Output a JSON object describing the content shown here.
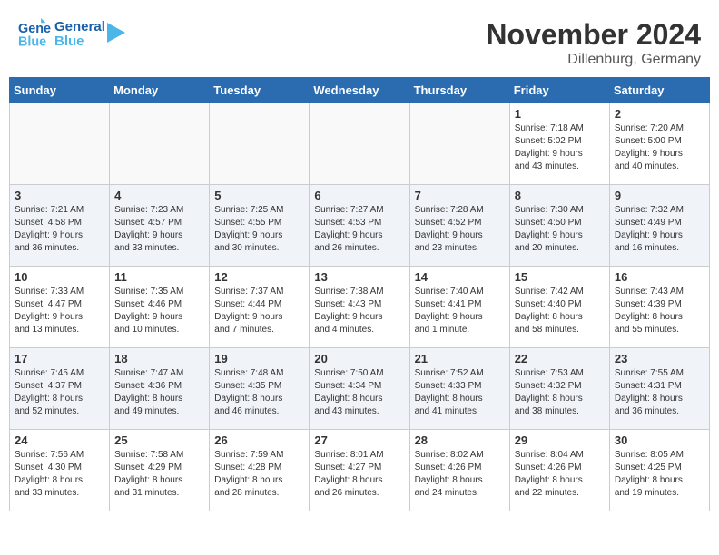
{
  "logo": {
    "line1": "General",
    "line2": "Blue"
  },
  "title": "November 2024",
  "location": "Dillenburg, Germany",
  "days_of_week": [
    "Sunday",
    "Monday",
    "Tuesday",
    "Wednesday",
    "Thursday",
    "Friday",
    "Saturday"
  ],
  "weeks": [
    [
      {
        "day": "",
        "info": ""
      },
      {
        "day": "",
        "info": ""
      },
      {
        "day": "",
        "info": ""
      },
      {
        "day": "",
        "info": ""
      },
      {
        "day": "",
        "info": ""
      },
      {
        "day": "1",
        "info": "Sunrise: 7:18 AM\nSunset: 5:02 PM\nDaylight: 9 hours\nand 43 minutes."
      },
      {
        "day": "2",
        "info": "Sunrise: 7:20 AM\nSunset: 5:00 PM\nDaylight: 9 hours\nand 40 minutes."
      }
    ],
    [
      {
        "day": "3",
        "info": "Sunrise: 7:21 AM\nSunset: 4:58 PM\nDaylight: 9 hours\nand 36 minutes."
      },
      {
        "day": "4",
        "info": "Sunrise: 7:23 AM\nSunset: 4:57 PM\nDaylight: 9 hours\nand 33 minutes."
      },
      {
        "day": "5",
        "info": "Sunrise: 7:25 AM\nSunset: 4:55 PM\nDaylight: 9 hours\nand 30 minutes."
      },
      {
        "day": "6",
        "info": "Sunrise: 7:27 AM\nSunset: 4:53 PM\nDaylight: 9 hours\nand 26 minutes."
      },
      {
        "day": "7",
        "info": "Sunrise: 7:28 AM\nSunset: 4:52 PM\nDaylight: 9 hours\nand 23 minutes."
      },
      {
        "day": "8",
        "info": "Sunrise: 7:30 AM\nSunset: 4:50 PM\nDaylight: 9 hours\nand 20 minutes."
      },
      {
        "day": "9",
        "info": "Sunrise: 7:32 AM\nSunset: 4:49 PM\nDaylight: 9 hours\nand 16 minutes."
      }
    ],
    [
      {
        "day": "10",
        "info": "Sunrise: 7:33 AM\nSunset: 4:47 PM\nDaylight: 9 hours\nand 13 minutes."
      },
      {
        "day": "11",
        "info": "Sunrise: 7:35 AM\nSunset: 4:46 PM\nDaylight: 9 hours\nand 10 minutes."
      },
      {
        "day": "12",
        "info": "Sunrise: 7:37 AM\nSunset: 4:44 PM\nDaylight: 9 hours\nand 7 minutes."
      },
      {
        "day": "13",
        "info": "Sunrise: 7:38 AM\nSunset: 4:43 PM\nDaylight: 9 hours\nand 4 minutes."
      },
      {
        "day": "14",
        "info": "Sunrise: 7:40 AM\nSunset: 4:41 PM\nDaylight: 9 hours\nand 1 minute."
      },
      {
        "day": "15",
        "info": "Sunrise: 7:42 AM\nSunset: 4:40 PM\nDaylight: 8 hours\nand 58 minutes."
      },
      {
        "day": "16",
        "info": "Sunrise: 7:43 AM\nSunset: 4:39 PM\nDaylight: 8 hours\nand 55 minutes."
      }
    ],
    [
      {
        "day": "17",
        "info": "Sunrise: 7:45 AM\nSunset: 4:37 PM\nDaylight: 8 hours\nand 52 minutes."
      },
      {
        "day": "18",
        "info": "Sunrise: 7:47 AM\nSunset: 4:36 PM\nDaylight: 8 hours\nand 49 minutes."
      },
      {
        "day": "19",
        "info": "Sunrise: 7:48 AM\nSunset: 4:35 PM\nDaylight: 8 hours\nand 46 minutes."
      },
      {
        "day": "20",
        "info": "Sunrise: 7:50 AM\nSunset: 4:34 PM\nDaylight: 8 hours\nand 43 minutes."
      },
      {
        "day": "21",
        "info": "Sunrise: 7:52 AM\nSunset: 4:33 PM\nDaylight: 8 hours\nand 41 minutes."
      },
      {
        "day": "22",
        "info": "Sunrise: 7:53 AM\nSunset: 4:32 PM\nDaylight: 8 hours\nand 38 minutes."
      },
      {
        "day": "23",
        "info": "Sunrise: 7:55 AM\nSunset: 4:31 PM\nDaylight: 8 hours\nand 36 minutes."
      }
    ],
    [
      {
        "day": "24",
        "info": "Sunrise: 7:56 AM\nSunset: 4:30 PM\nDaylight: 8 hours\nand 33 minutes."
      },
      {
        "day": "25",
        "info": "Sunrise: 7:58 AM\nSunset: 4:29 PM\nDaylight: 8 hours\nand 31 minutes."
      },
      {
        "day": "26",
        "info": "Sunrise: 7:59 AM\nSunset: 4:28 PM\nDaylight: 8 hours\nand 28 minutes."
      },
      {
        "day": "27",
        "info": "Sunrise: 8:01 AM\nSunset: 4:27 PM\nDaylight: 8 hours\nand 26 minutes."
      },
      {
        "day": "28",
        "info": "Sunrise: 8:02 AM\nSunset: 4:26 PM\nDaylight: 8 hours\nand 24 minutes."
      },
      {
        "day": "29",
        "info": "Sunrise: 8:04 AM\nSunset: 4:26 PM\nDaylight: 8 hours\nand 22 minutes."
      },
      {
        "day": "30",
        "info": "Sunrise: 8:05 AM\nSunset: 4:25 PM\nDaylight: 8 hours\nand 19 minutes."
      }
    ]
  ]
}
